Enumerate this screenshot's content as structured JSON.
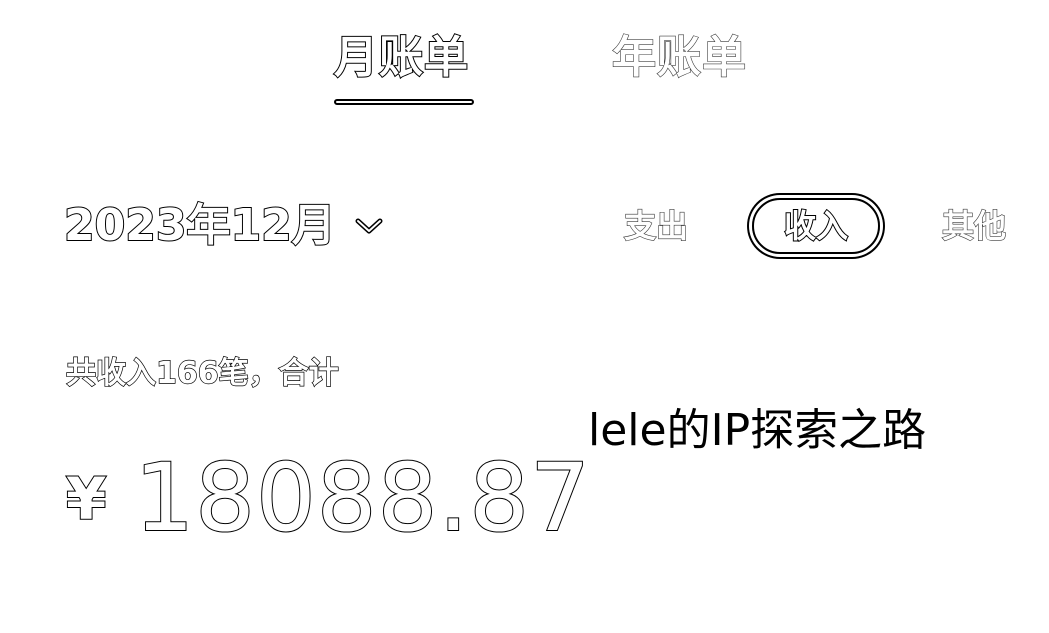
{
  "tabs": {
    "month_label": "月账单",
    "year_label": "年账单",
    "active": "month"
  },
  "period": {
    "label": "2023年12月",
    "chevron_icon": "chevron-down-icon"
  },
  "filters": {
    "expense_label": "支出",
    "income_label": "收入",
    "other_label": "其他",
    "active": "income"
  },
  "summary": {
    "text": "共收入166笔，合计",
    "currency_symbol": "¥",
    "amount": "18088.87"
  },
  "watermark": {
    "text": "lele的IP探索之路"
  }
}
